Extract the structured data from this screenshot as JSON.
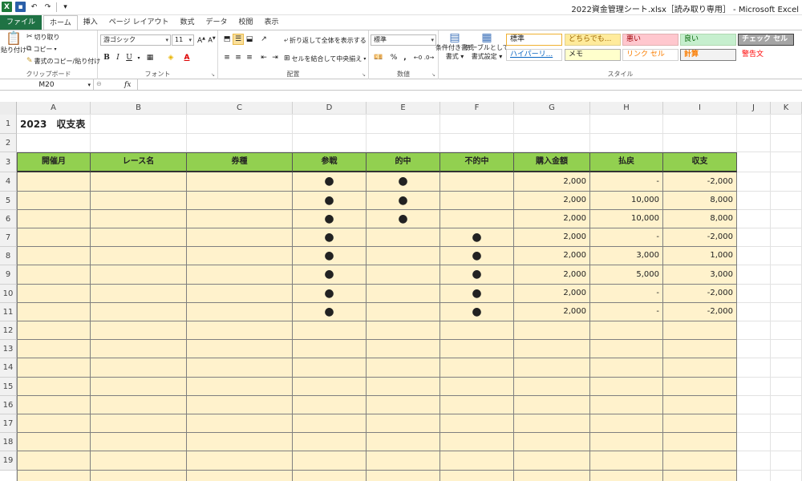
{
  "window": {
    "title": "2022資金管理シート.xlsx［読み取り専用］ - Microsoft Excel",
    "qat_icons": [
      "excel-icon",
      "save-icon",
      "undo-icon",
      "redo-icon",
      "customize-qat-icon"
    ]
  },
  "tabs": [
    "ファイル",
    "ホーム",
    "挿入",
    "ページ レイアウト",
    "数式",
    "データ",
    "校閲",
    "表示"
  ],
  "ribbon": {
    "clipboard": {
      "paste": "貼り付け",
      "cut": "切り取り",
      "copy": "コピー",
      "format_painter": "書式のコピー/貼り付け",
      "label": "クリップボード"
    },
    "font": {
      "name": "游ゴシック",
      "size": "11",
      "bold": "B",
      "italic": "I",
      "underline": "U",
      "label": "フォント"
    },
    "alignment": {
      "wrap": "折り返して全体を表示する",
      "merge": "セルを結合して中央揃え",
      "label": "配置"
    },
    "number": {
      "format": "標準",
      "percent": "%",
      "comma": ",",
      "inc_decimal": "⁺⁰.₀₀",
      "dec_decimal": ".₀₀→",
      "label": "数値"
    },
    "styles": {
      "conditional": "条件付き書式",
      "conditional_sub": "書式 ▾",
      "table": "テーブルとして",
      "table_sub": "書式設定 ▾",
      "cells": [
        {
          "text": "標準",
          "bg": "#ffffff",
          "fg": "#222222",
          "border": "#f0b030"
        },
        {
          "text": "どちらでも...",
          "bg": "#ffeb9c",
          "fg": "#9c6500",
          "border": "#e0d090"
        },
        {
          "text": "悪い",
          "bg": "#ffc7ce",
          "fg": "#9c0006",
          "border": "#e0b0b0"
        },
        {
          "text": "良い",
          "bg": "#c6efce",
          "fg": "#006100",
          "border": "#b0d8b0"
        },
        {
          "text": "チェック セル",
          "bg": "#a5a5a5",
          "fg": "#ffffff",
          "border": "#3f3f3f"
        },
        {
          "text": "ハイパーリ...",
          "bg": "#ffffff",
          "fg": "#0563c1",
          "border": "#d0d0d0"
        },
        {
          "text": "メモ",
          "bg": "#ffffcc",
          "fg": "#222222",
          "border": "#b2b2b2"
        },
        {
          "text": "リンク セル",
          "bg": "#ffffff",
          "fg": "#fa7d00",
          "border": "#d0d0d0"
        },
        {
          "text": "計算",
          "bg": "#f2f2f2",
          "fg": "#fa7d00",
          "border": "#7f7f7f"
        },
        {
          "text": "警告文",
          "bg": "#ffffff",
          "fg": "#ff0000",
          "border": "#ffffff"
        }
      ],
      "label": "スタイル"
    }
  },
  "formula_bar": {
    "name_box": "M20",
    "fx": "fx",
    "value": ""
  },
  "columns": [
    "A",
    "B",
    "C",
    "D",
    "E",
    "F",
    "G",
    "H",
    "I",
    "J",
    "K"
  ],
  "sheet": {
    "title": "2023　収支表",
    "headers": [
      "開催月",
      "レース名",
      "券種",
      "参戦",
      "的中",
      "不的中",
      "購入金額",
      "払戻",
      "収支"
    ],
    "rows": [
      [
        "",
        "",
        "",
        "●",
        "●",
        "",
        "2,000",
        "-",
        "-2,000"
      ],
      [
        "",
        "",
        "",
        "●",
        "●",
        "",
        "2,000",
        "10,000",
        "8,000"
      ],
      [
        "",
        "",
        "",
        "●",
        "●",
        "",
        "2,000",
        "10,000",
        "8,000"
      ],
      [
        "",
        "",
        "",
        "●",
        "",
        "●",
        "2,000",
        "-",
        "-2,000"
      ],
      [
        "",
        "",
        "",
        "●",
        "",
        "●",
        "2,000",
        "3,000",
        "1,000"
      ],
      [
        "",
        "",
        "",
        "●",
        "",
        "●",
        "2,000",
        "5,000",
        "3,000"
      ],
      [
        "",
        "",
        "",
        "●",
        "",
        "●",
        "2,000",
        "-",
        "-2,000"
      ],
      [
        "",
        "",
        "",
        "●",
        "",
        "●",
        "2,000",
        "-",
        "-2,000"
      ],
      [
        "",
        "",
        "",
        "",
        "",
        "",
        "",
        "",
        ""
      ],
      [
        "",
        "",
        "",
        "",
        "",
        "",
        "",
        "",
        ""
      ],
      [
        "",
        "",
        "",
        "",
        "",
        "",
        "",
        "",
        ""
      ],
      [
        "",
        "",
        "",
        "",
        "",
        "",
        "",
        "",
        ""
      ],
      [
        "",
        "",
        "",
        "",
        "",
        "",
        "",
        "",
        ""
      ],
      [
        "",
        "",
        "",
        "",
        "",
        "",
        "",
        "",
        ""
      ],
      [
        "",
        "",
        "",
        "",
        "",
        "",
        "",
        "",
        ""
      ],
      [
        "",
        "",
        "",
        "",
        "",
        "",
        "",
        "",
        ""
      ],
      [
        "",
        "",
        "",
        "",
        "",
        "",
        "",
        "",
        ""
      ]
    ],
    "row_numbers": [
      "1",
      "2",
      "3",
      "4",
      "5",
      "6",
      "7",
      "8",
      "9",
      "10",
      "11",
      "12",
      "13",
      "14",
      "15",
      "16",
      "17",
      "18",
      "19"
    ]
  },
  "colors": {
    "header_green": "#92d050",
    "data_fill": "#fff2cc",
    "file_tab": "#1f7244"
  }
}
